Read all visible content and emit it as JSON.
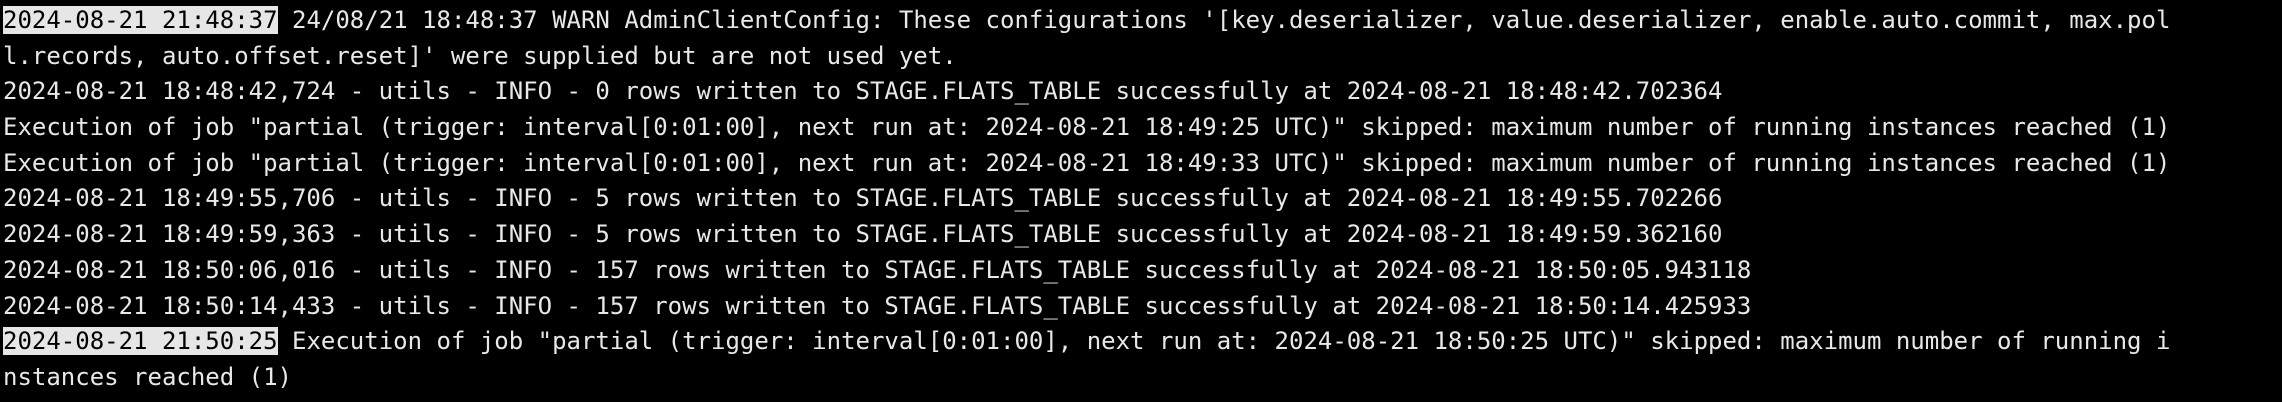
{
  "colors": {
    "background": "#000000",
    "text": "#e8e8e8",
    "highlight_bg": "#e6e6e6",
    "highlight_text": "#000000"
  },
  "terminal": {
    "lines": [
      {
        "ts": "2024-08-21 21:48:37",
        "text": " 24/08/21 18:48:37 WARN AdminClientConfig: These configurations '[key.deserializer, value.deserializer, enable.auto.commit, max.pol"
      },
      {
        "text": "l.records, auto.offset.reset]' were supplied but are not used yet."
      },
      {
        "text": "2024-08-21 18:48:42,724 - utils - INFO - 0 rows written to STAGE.FLATS_TABLE successfully at 2024-08-21 18:48:42.702364"
      },
      {
        "text": "Execution of job \"partial (trigger: interval[0:01:00], next run at: 2024-08-21 18:49:25 UTC)\" skipped: maximum number of running instances reached (1)"
      },
      {
        "text": "Execution of job \"partial (trigger: interval[0:01:00], next run at: 2024-08-21 18:49:33 UTC)\" skipped: maximum number of running instances reached (1)"
      },
      {
        "text": "2024-08-21 18:49:55,706 - utils - INFO - 5 rows written to STAGE.FLATS_TABLE successfully at 2024-08-21 18:49:55.702266"
      },
      {
        "text": "2024-08-21 18:49:59,363 - utils - INFO - 5 rows written to STAGE.FLATS_TABLE successfully at 2024-08-21 18:49:59.362160"
      },
      {
        "text": "2024-08-21 18:50:06,016 - utils - INFO - 157 rows written to STAGE.FLATS_TABLE successfully at 2024-08-21 18:50:05.943118"
      },
      {
        "text": "2024-08-21 18:50:14,433 - utils - INFO - 157 rows written to STAGE.FLATS_TABLE successfully at 2024-08-21 18:50:14.425933"
      },
      {
        "ts": "2024-08-21 21:50:25",
        "text": " Execution of job \"partial (trigger: interval[0:01:00], next run at: 2024-08-21 18:50:25 UTC)\" skipped: maximum number of running i"
      },
      {
        "text": "nstances reached (1)"
      }
    ]
  }
}
